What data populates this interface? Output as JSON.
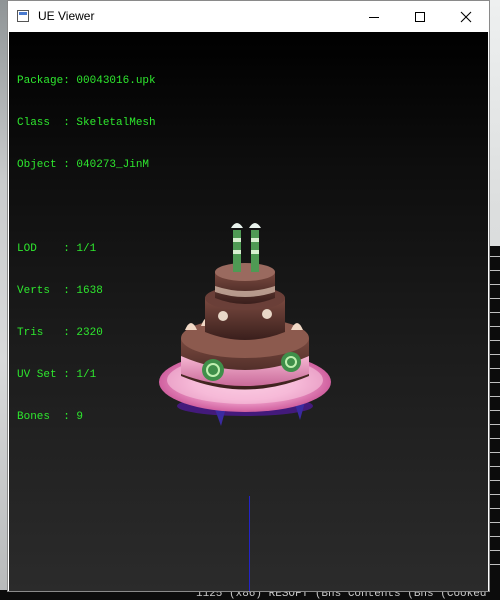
{
  "window": {
    "title": "UE Viewer",
    "icon": "app-window-icon",
    "controls": [
      "minimize-icon",
      "maximize-icon",
      "close-icon"
    ]
  },
  "info": {
    "package_label": "Package:",
    "package_value": "00043016.upk",
    "class_label": "Class  :",
    "class_value": "SkeletalMesh",
    "object_label": "Object :",
    "object_value": "040273_JinM",
    "lod_label": "LOD    :",
    "lod_value": "1/1",
    "verts_label": "Verts  :",
    "verts_value": "1638",
    "tris_label": "Tris   :",
    "tris_value": "2320",
    "uvset_label": "UV Set :",
    "uvset_value": "1/1",
    "bones_label": "Bones  :",
    "bones_value": "9"
  },
  "colors": {
    "info_text": "#2ee82e",
    "axis": "#2323c8",
    "viewport_top": "#000000",
    "viewport_bottom": "#2b2b2b"
  },
  "background": {
    "console_bottom_text": "1125 (x86) RESOFT (Bns Contents (Bns (Cooked"
  }
}
